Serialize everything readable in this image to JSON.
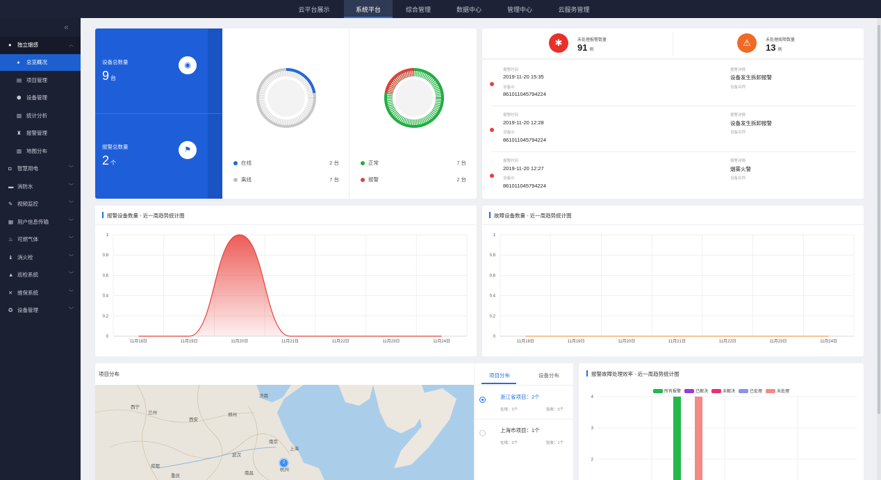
{
  "topnav": {
    "tabs": [
      "云平台展示",
      "系统平台",
      "综合管理",
      "数据中心",
      "管理中心",
      "云服务管理"
    ],
    "active": 1
  },
  "sidebar": {
    "group": "独立烟感",
    "subitems": [
      "总览概况",
      "项目管理",
      "设备管理",
      "统计分析",
      "报警管理",
      "地图分布"
    ],
    "active_sub": 0,
    "items": [
      "智慧用电",
      "消防水",
      "视频监控",
      "用户信息传输",
      "可燃气体",
      "消火栓",
      "巡检系统",
      "维保系统",
      "设备管理"
    ]
  },
  "summary": {
    "device_total_label": "设备总数量",
    "device_total": "9",
    "device_unit": "台",
    "alarm_total_label": "报警总数量",
    "alarm_total": "2",
    "alarm_unit": "个"
  },
  "status_online": {
    "online_label": "在线",
    "online_value": "2 台",
    "offline_label": "离线",
    "offline_value": "7 台",
    "online_fraction": 0.222
  },
  "status_alarm": {
    "normal_label": "正常",
    "normal_value": "7 台",
    "alarm_label": "报警",
    "alarm_value": "2 台",
    "alarm_fraction": 0.222
  },
  "alarms": {
    "unhandled_alarm_label": "未处理报警数量",
    "unhandled_alarm": "91",
    "unhandled_alarm_unit": "例",
    "unhandled_fault_label": "未处理故障数量",
    "unhandled_fault": "13",
    "unhandled_fault_unit": "例",
    "items": [
      {
        "time_label": "报警时间",
        "time": "2019-11-20 15:35",
        "id_label": "设备ID",
        "id": "861011045794224",
        "detail_label": "报警详情",
        "detail": "设备发生拆卸报警",
        "name_label": "设备名称"
      },
      {
        "time_label": "报警时间",
        "time": "2019-11-20 12:28",
        "id_label": "设备ID",
        "id": "861011045794224",
        "detail_label": "报警详情",
        "detail": "设备发生拆卸报警",
        "name_label": "设备名称"
      },
      {
        "time_label": "报警时间",
        "time": "2019-11-20 12:27",
        "id_label": "设备ID",
        "id": "861011045794224",
        "detail_label": "报警详情",
        "detail": "烟雾火警",
        "name_label": "设备名称"
      }
    ]
  },
  "chart_data": [
    {
      "type": "area",
      "title": "报警设备数量 - 近一周趋势统计图",
      "categories": [
        "11月18日",
        "11月19日",
        "11月20日",
        "11月21日",
        "11月22日",
        "11月23日",
        "11月24日"
      ],
      "series": [
        {
          "values": [
            0,
            0,
            1,
            0,
            0,
            0,
            0
          ]
        }
      ],
      "yticks": [
        "1",
        "0.8",
        "0.6",
        "0.4",
        "0.2",
        "0"
      ],
      "ylim": [
        0,
        1
      ],
      "color": "#e8403a"
    },
    {
      "type": "line",
      "title": "故障设备数量 - 近一周趋势统计图",
      "categories": [
        "11月18日",
        "11月19日",
        "11月20日",
        "11月21日",
        "11月22日",
        "11月23日",
        "11月24日"
      ],
      "series": [
        {
          "values": [
            0,
            0,
            0,
            0,
            0,
            0,
            0
          ]
        }
      ],
      "yticks": [
        "1",
        "0.8",
        "0.6",
        "0.4",
        "0.2",
        "0"
      ],
      "ylim": [
        0,
        1
      ],
      "color": "#f0a050"
    },
    {
      "type": "bar",
      "title": "报警故障处理效率 - 近一周趋势统计图",
      "legend": [
        "所有报警",
        "已解决",
        "未解决",
        "已处理",
        "未处理"
      ],
      "legend_colors": [
        "#22b84a",
        "#9b3bdc",
        "#e8317a",
        "#8c93ea",
        "#f28a86"
      ],
      "yticks": [
        "4",
        "3",
        "2"
      ]
    }
  ],
  "map": {
    "title": "项目分布",
    "cities": [
      "济南",
      "西宁",
      "兰州",
      "西安",
      "郑州",
      "南京",
      "上海",
      "武汉",
      "成都",
      "重庆",
      "杭州",
      "南昌"
    ],
    "cluster_count": "2"
  },
  "projects": {
    "tabs": [
      "项目分布",
      "设备分布"
    ],
    "active": 0,
    "items": [
      {
        "name": "浙江省项目：2个",
        "online": "在线：2个",
        "check": "验收：0个"
      },
      {
        "name": "上海市项目：1个",
        "online": "在线：0个",
        "check": "验收：1个"
      }
    ]
  }
}
